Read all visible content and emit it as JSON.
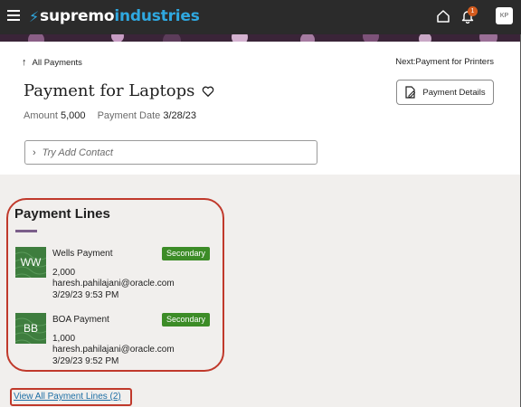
{
  "header": {
    "logo_part1": "supremo",
    "logo_part2": "industries",
    "notification_count": "1",
    "avatar_initials": "KP"
  },
  "nav": {
    "back_label": "All Payments",
    "next_label": "Next:Payment for Printers"
  },
  "record": {
    "title": "Payment for Laptops",
    "amount_label": "Amount",
    "amount_value": "5,000",
    "date_label": "Payment Date",
    "date_value": "3/28/23",
    "details_button": "Payment Details",
    "contact_placeholder": "Try Add Contact"
  },
  "payment_lines": {
    "heading": "Payment Lines",
    "items": [
      {
        "initials": "WW",
        "name": "Wells Payment",
        "badge": "Secondary",
        "amount": "2,000",
        "email": "haresh.pahilajani@oracle.com",
        "timestamp": "3/29/23 9:53 PM"
      },
      {
        "initials": "BB",
        "name": "BOA Payment",
        "badge": "Secondary",
        "amount": "1,000",
        "email": "haresh.pahilajani@oracle.com",
        "timestamp": "3/29/23 9:52 PM"
      }
    ],
    "view_all_label": "View All Payment Lines (2)"
  },
  "colors": {
    "header_bg": "#2b2b2b",
    "brand_blue": "#2fa8e0",
    "badge_green": "#3c8c27",
    "thumb_green": "#3e7d3e",
    "highlight_red": "#c0392b",
    "link_blue": "#1d6fa5"
  },
  "icons": {
    "menu": "hamburger-icon",
    "home": "home-icon",
    "notifications": "bell-icon",
    "favorite": "heart-icon",
    "details": "document-edit-icon",
    "back": "arrow-up-icon",
    "expand": "chevron-right-icon"
  }
}
